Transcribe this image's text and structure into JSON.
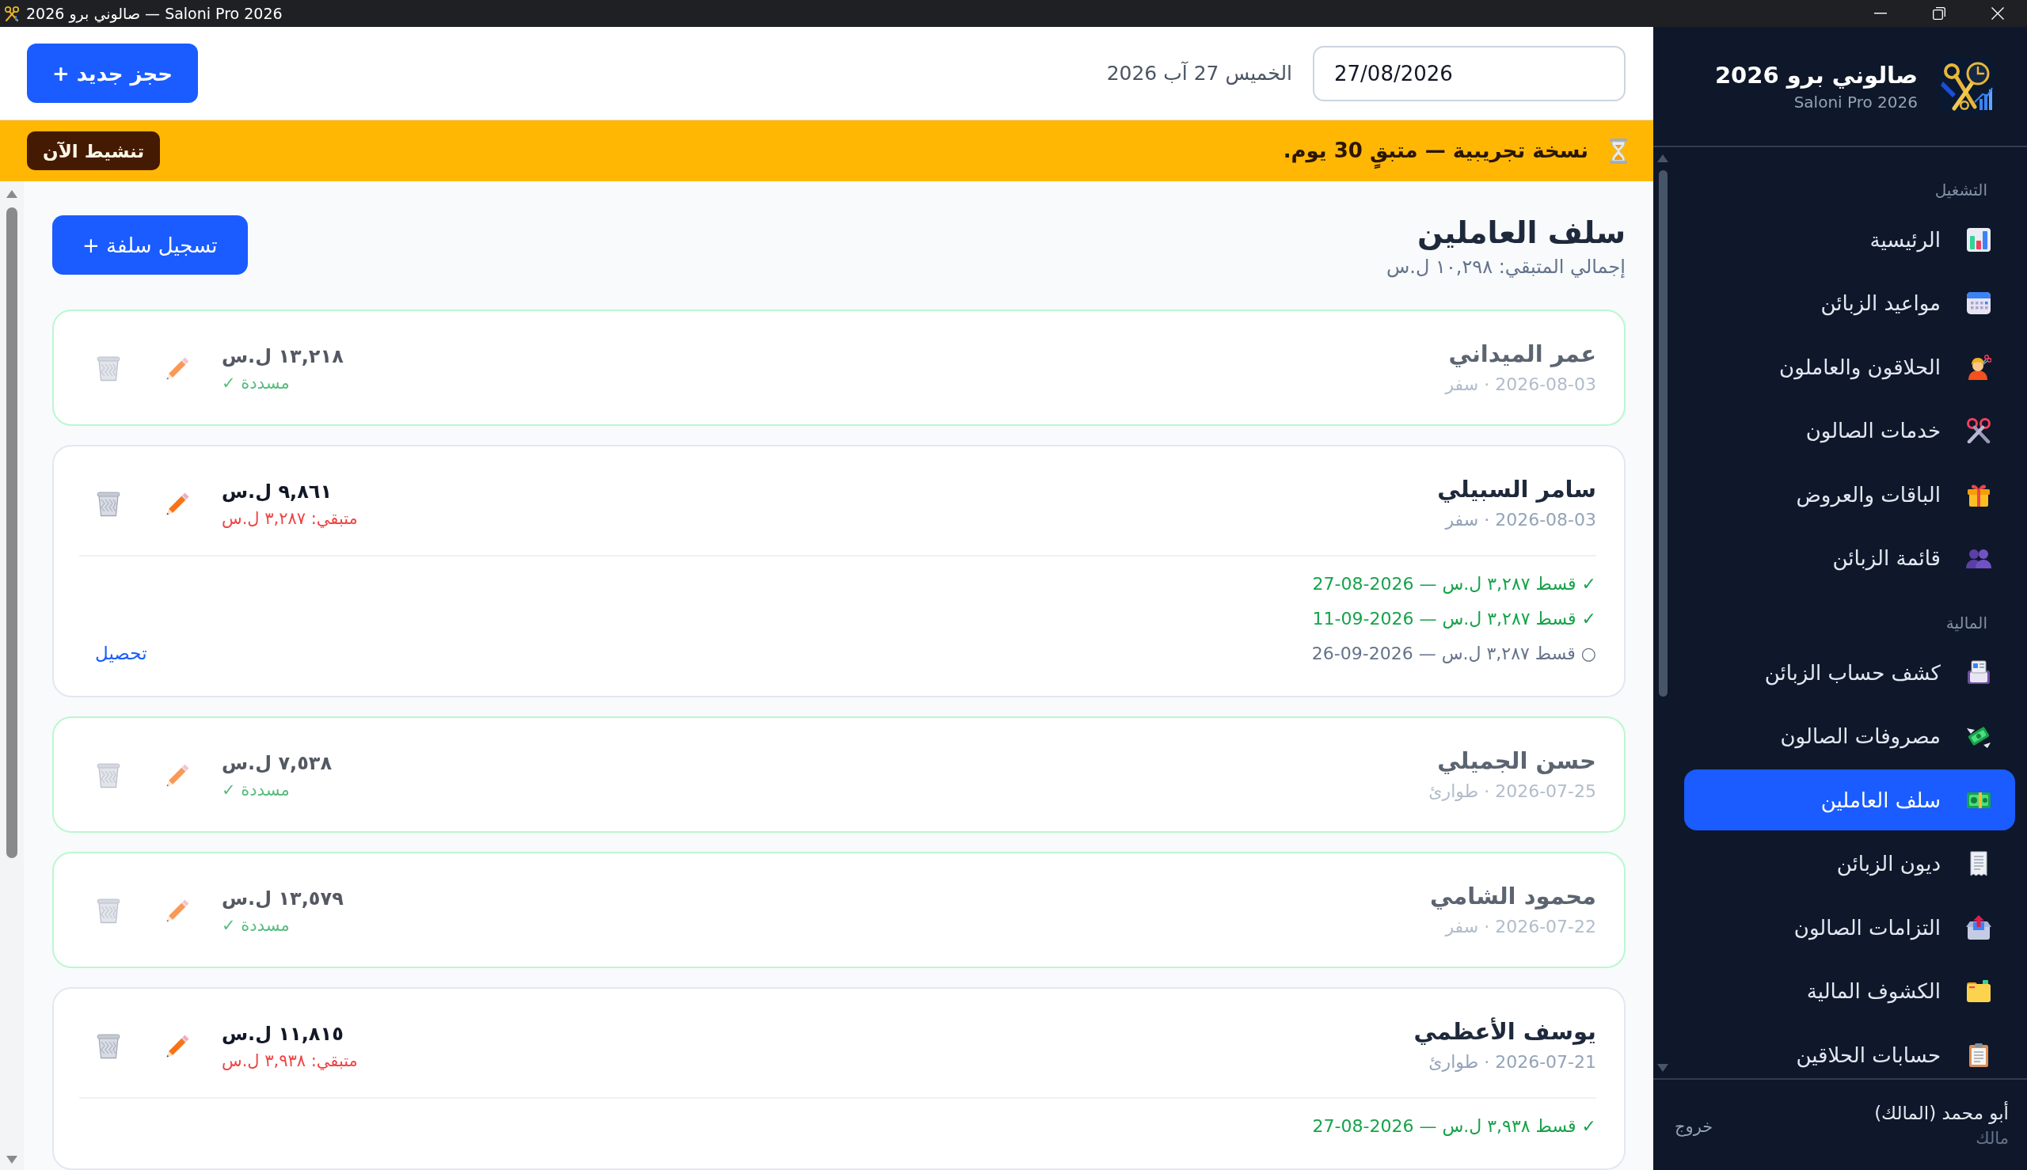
{
  "window": {
    "title": "صالوني برو 2026 — Saloni Pro 2026"
  },
  "sidebar": {
    "app_name": "صالوني برو 2026",
    "app_subtitle": "Saloni Pro 2026",
    "sections": [
      {
        "label": "التشغيل",
        "items": [
          {
            "label": "الرئيسية",
            "selected": false
          },
          {
            "label": "مواعيد الزبائن",
            "selected": false
          },
          {
            "label": "الحلاقون والعاملون",
            "selected": false
          },
          {
            "label": "خدمات الصالون",
            "selected": false
          },
          {
            "label": "الباقات والعروض",
            "selected": false
          },
          {
            "label": "قائمة الزبائن",
            "selected": false
          }
        ]
      },
      {
        "label": "المالية",
        "items": [
          {
            "label": "كشف حساب الزبائن",
            "selected": false
          },
          {
            "label": "مصروفات الصالون",
            "selected": false
          },
          {
            "label": "سلف العاملين",
            "selected": true
          },
          {
            "label": "ديون الزبائن",
            "selected": false
          },
          {
            "label": "التزامات الصالون",
            "selected": false
          },
          {
            "label": "الكشوف المالية",
            "selected": false
          },
          {
            "label": "حسابات الحلاقين",
            "selected": false
          }
        ]
      }
    ],
    "user": {
      "name": "أبو محمد (المالك)",
      "role": "مالك",
      "logout": "خروج"
    }
  },
  "header": {
    "date_field": {
      "value": "27/08/2026"
    },
    "date_text": "الخميس 27 آب 2026",
    "new_booking_button": "+ حجز جديد"
  },
  "banner": {
    "message": "نسخة تجريبية — متبقٍ 30 يوم.",
    "activate_button": "تنشيط الآن"
  },
  "page": {
    "title": "سلف العاملين",
    "summary": "إجمالي المتبقي: ١٠,٢٩٨ ل.س",
    "add_button": "+ تسجيل سلفة",
    "advances": [
      {
        "name": "عمر الميداني",
        "meta": "2026-08-03 · سفر",
        "amount": "١٣,٢١٨ ل.س",
        "status": "مسددة ✓",
        "settled": true
      },
      {
        "name": "سامر السبيلي",
        "meta": "2026-08-03 · سفر",
        "amount": "٩,٨٦١ ل.س",
        "status": "متبقي: ٣,٢٨٧ ل.س",
        "settled": false,
        "installments": [
          {
            "text": "✓ قسط ٣,٢٨٧ ل.س — 27-08-2026",
            "paid": true
          },
          {
            "text": "✓ قسط ٣,٢٨٧ ل.س — 11-09-2026",
            "paid": true
          },
          {
            "text": "○ قسط ٣,٢٨٧ ل.س — 26-09-2026",
            "paid": false,
            "action": "تحصيل"
          }
        ]
      },
      {
        "name": "حسن الجميلي",
        "meta": "2026-07-25 · طوارئ",
        "amount": "٧,٥٣٨ ل.س",
        "status": "مسددة ✓",
        "settled": true
      },
      {
        "name": "محمود الشامي",
        "meta": "2026-07-22 · سفر",
        "amount": "١٣,٥٧٩ ل.س",
        "status": "مسددة ✓",
        "settled": true
      },
      {
        "name": "يوسف الأعظمي",
        "meta": "2026-07-21 · طوارئ",
        "amount": "١١,٨١٥ ل.س",
        "status": "متبقي: ٣,٩٣٨ ل.س",
        "settled": false,
        "installments": [
          {
            "text": "✓ قسط ٣,٩٣٨ ل.س — 27-08-2026",
            "paid": true
          }
        ]
      }
    ]
  }
}
